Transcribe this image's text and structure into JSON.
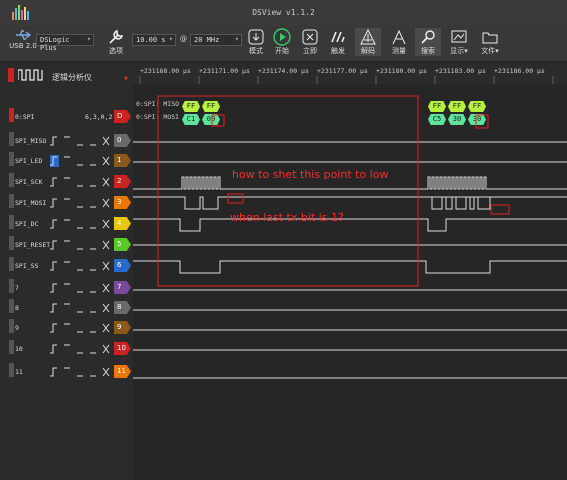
{
  "window": {
    "title": "DSView v1.1.2"
  },
  "toolbar": {
    "usb_label": "USB 2.0",
    "device": "DSLogic Plus",
    "options_label": "选项",
    "time_value": "10.00 s",
    "at": "@",
    "rate_value": "20 MHz",
    "mode_label": "模式",
    "start_label": "开始",
    "instant_label": "立即",
    "trigger_label": "触发",
    "decode_label": "解码",
    "measure_label": "测量",
    "search_label": "搜索",
    "display_label": "显示",
    "file_label": "文件"
  },
  "ruler": {
    "ticks": [
      "+231168.00 µs",
      "+231171.00 µs",
      "+231174.00 µs",
      "+231177.00 µs",
      "+231180.00 µs",
      "+231183.00 µs",
      "+231186.00 µs"
    ]
  },
  "analyzer": {
    "title": "逻辑分析仪"
  },
  "decoder": {
    "name": "0:SPI",
    "channels": "6,3,0,2",
    "badge": "D",
    "miso_label": "0:SPI: MISO",
    "mosi_label": "0:SPI: MOSI",
    "miso_values_left": [
      "FF",
      "FF"
    ],
    "mosi_values_left": [
      "C1",
      "00"
    ],
    "miso_values_right": [
      "FF",
      "FF",
      "FF"
    ],
    "mosi_values_right": [
      "C5",
      "30",
      "30"
    ]
  },
  "channels": [
    {
      "name": "SPI_MISO",
      "index": "0",
      "color": "#6a6a6a"
    },
    {
      "name": "SPI_LED",
      "index": "1",
      "color": "#8a5a1a"
    },
    {
      "name": "SPI_SCK",
      "index": "2",
      "color": "#cc2222"
    },
    {
      "name": "SPI_MOSI",
      "index": "3",
      "color": "#ee7700"
    },
    {
      "name": "SPI_DC",
      "index": "4",
      "color": "#e8c800"
    },
    {
      "name": "SPI_RESET",
      "index": "5",
      "color": "#5ac828"
    },
    {
      "name": "SPI_SS",
      "index": "6",
      "color": "#2a6acc"
    },
    {
      "name": "7",
      "index": "7",
      "color": "#7a4a9a"
    },
    {
      "name": "8",
      "index": "8",
      "color": "#6a6a6a"
    },
    {
      "name": "9",
      "index": "9",
      "color": "#8a5a1a"
    },
    {
      "name": "10",
      "index": "10",
      "color": "#cc2222"
    },
    {
      "name": "11",
      "index": "11",
      "color": "#ee7700"
    }
  ],
  "annotations": {
    "line1": "how to shet this point to low",
    "line2": "when last tx bit is 1?"
  }
}
